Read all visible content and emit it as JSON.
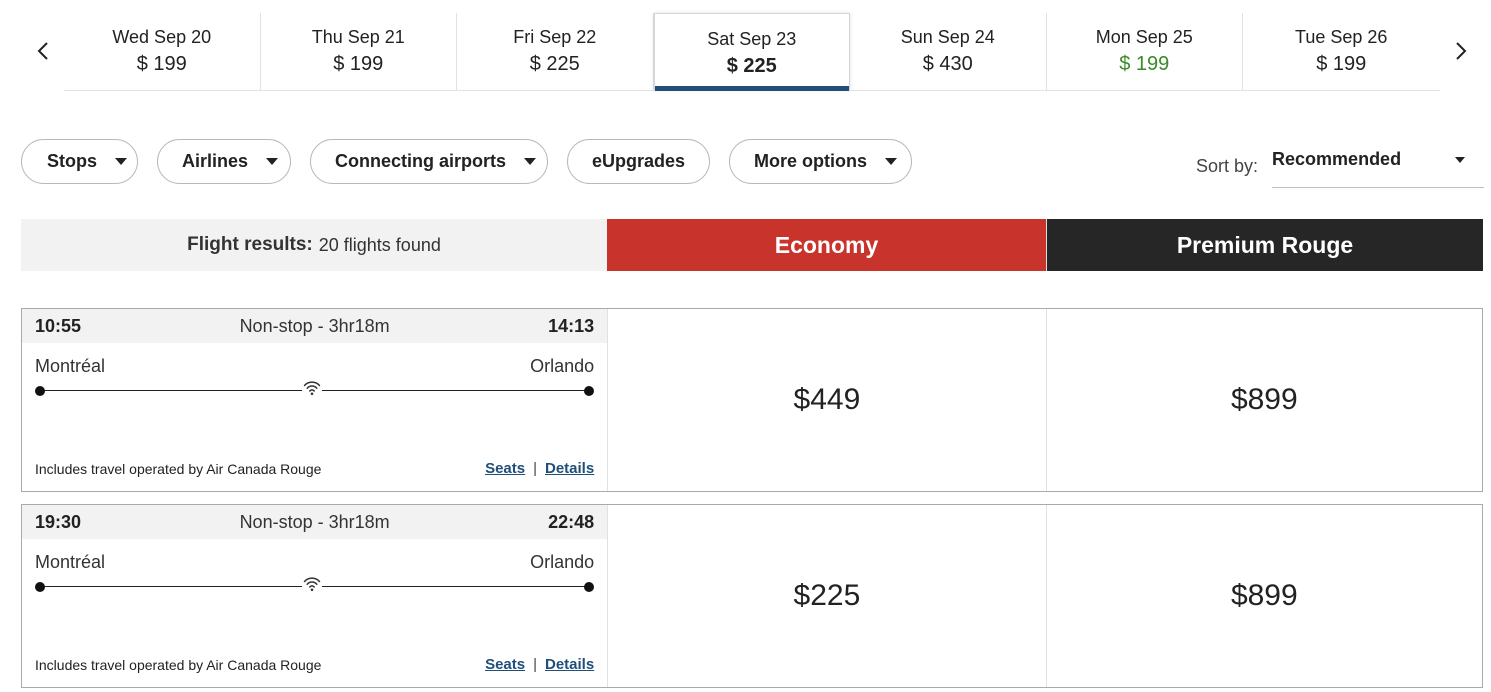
{
  "date_strip": {
    "dates": [
      {
        "label": "Wed Sep 20",
        "price": "$ 199"
      },
      {
        "label": "Thu Sep 21",
        "price": "$ 199"
      },
      {
        "label": "Fri Sep 22",
        "price": "$ 225"
      },
      {
        "label": "Sat Sep 23",
        "price": "$ 225",
        "selected": true
      },
      {
        "label": "Sun Sep 24",
        "price": "$ 430"
      },
      {
        "label": "Mon Sep 25",
        "price": "$ 199",
        "lowest": true
      },
      {
        "label": "Tue Sep 26",
        "price": "$ 199"
      }
    ],
    "prev_icon": "chevron-left-icon",
    "next_icon": "chevron-right-icon"
  },
  "filters": {
    "stops": "Stops",
    "airlines": "Airlines",
    "connecting_airports": "Connecting airports",
    "eupgrades": "eUpgrades",
    "more_options": "More options"
  },
  "sort": {
    "label": "Sort by:",
    "value": "Recommended"
  },
  "results_header": {
    "title": "Flight results:",
    "count": "20 flights found",
    "economy": "Economy",
    "premium": "Premium Rouge"
  },
  "flights": [
    {
      "depart": "10:55",
      "duration": "Non-stop - 3hr18m",
      "arrive": "14:13",
      "origin": "Montréal",
      "destination": "Orlando",
      "note": "Includes travel operated by Air Canada Rouge",
      "seats": "Seats",
      "details": "Details",
      "economy_price": "$449",
      "premium_price": "$899"
    },
    {
      "depart": "19:30",
      "duration": "Non-stop - 3hr18m",
      "arrive": "22:48",
      "origin": "Montréal",
      "destination": "Orlando",
      "note": "Includes travel operated by Air Canada Rouge",
      "seats": "Seats",
      "details": "Details",
      "economy_price": "$225",
      "premium_price": "$899"
    }
  ],
  "colors": {
    "economy": "#c8332c",
    "premium": "#262626",
    "selected_underline": "#1f4f7a",
    "lowest_price": "#3a8a2a",
    "link": "#1f4f7a"
  }
}
